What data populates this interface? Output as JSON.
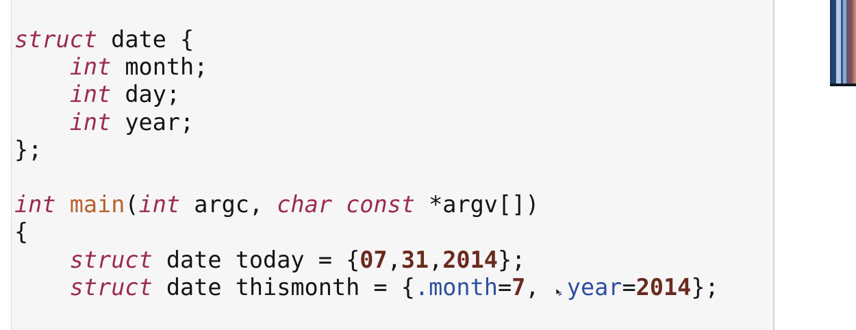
{
  "editor": {
    "lines": [
      {
        "tokens": [
          {
            "t": "struct",
            "c": "kw"
          },
          {
            "t": " date {",
            "c": "pl"
          }
        ]
      },
      {
        "tokens": [
          {
            "t": "    ",
            "c": "pl"
          },
          {
            "t": "int",
            "c": "kw"
          },
          {
            "t": " month;",
            "c": "pl"
          }
        ]
      },
      {
        "tokens": [
          {
            "t": "    ",
            "c": "pl"
          },
          {
            "t": "int",
            "c": "kw"
          },
          {
            "t": " day;",
            "c": "pl"
          }
        ]
      },
      {
        "tokens": [
          {
            "t": "    ",
            "c": "pl"
          },
          {
            "t": "int",
            "c": "kw"
          },
          {
            "t": " year;",
            "c": "pl"
          }
        ]
      },
      {
        "tokens": [
          {
            "t": "};",
            "c": "pl"
          }
        ]
      },
      {
        "tokens": []
      },
      {
        "tokens": [
          {
            "t": "int",
            "c": "kw"
          },
          {
            "t": " ",
            "c": "pl"
          },
          {
            "t": "main",
            "c": "fn"
          },
          {
            "t": "(",
            "c": "pl"
          },
          {
            "t": "int",
            "c": "kw"
          },
          {
            "t": " argc, ",
            "c": "pl"
          },
          {
            "t": "char",
            "c": "kw"
          },
          {
            "t": " ",
            "c": "pl"
          },
          {
            "t": "const",
            "c": "kw"
          },
          {
            "t": " *argv[])",
            "c": "pl"
          }
        ]
      },
      {
        "tokens": [
          {
            "t": "{",
            "c": "pl"
          }
        ]
      },
      {
        "tokens": [
          {
            "t": "    ",
            "c": "pl"
          },
          {
            "t": "struct",
            "c": "kw"
          },
          {
            "t": " date today = {",
            "c": "pl"
          },
          {
            "t": "07",
            "c": "num"
          },
          {
            "t": ",",
            "c": "pl"
          },
          {
            "t": "31",
            "c": "num"
          },
          {
            "t": ",",
            "c": "pl"
          },
          {
            "t": "2014",
            "c": "num"
          },
          {
            "t": "};",
            "c": "pl"
          }
        ]
      },
      {
        "tokens": [
          {
            "t": "    ",
            "c": "pl"
          },
          {
            "t": "struct",
            "c": "kw"
          },
          {
            "t": " date thismonth = {",
            "c": "pl"
          },
          {
            "t": ".month",
            "c": "mem"
          },
          {
            "t": "=",
            "c": "pl"
          },
          {
            "t": "7",
            "c": "num"
          },
          {
            "t": ", ",
            "c": "pl"
          },
          {
            "t": ".year",
            "c": "mem"
          },
          {
            "t": "=",
            "c": "pl"
          },
          {
            "t": "2014",
            "c": "num"
          },
          {
            "t": "};",
            "c": "pl"
          }
        ]
      }
    ]
  },
  "colors": {
    "keyword": "#9b2a55",
    "function": "#b8612e",
    "number": "#6a2a1e",
    "member": "#2d4fa0",
    "plain": "#141414",
    "editor_background": "#f6f6f6"
  },
  "icons": {
    "cursor": "mouse-pointer-icon",
    "thumbnail": "book-cover-thumbnail"
  }
}
